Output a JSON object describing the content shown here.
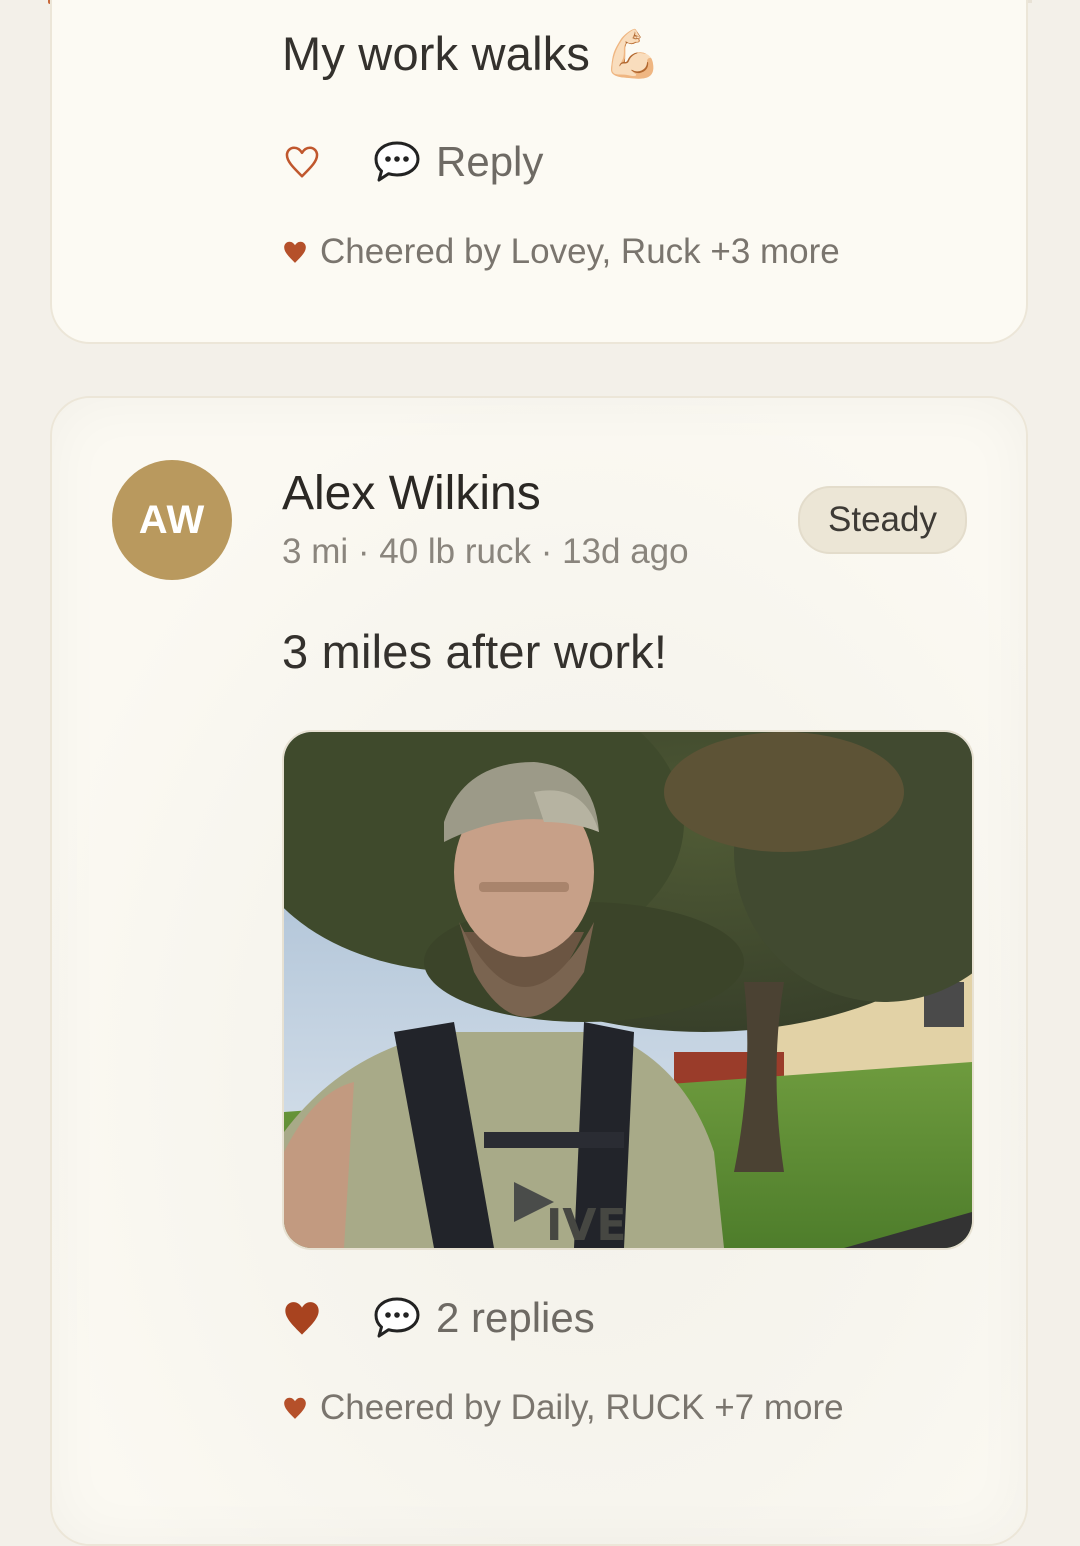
{
  "post1": {
    "text": "My work walks 💪🏻",
    "reply_label": "Reply",
    "cheers": "Cheered by Lovey, Ruck +3 more",
    "liked": false
  },
  "post2": {
    "avatar_initials": "AW",
    "author": "Alex Wilkins",
    "meta": "3 mi · 40 lb ruck · 13d ago",
    "badge": "Steady",
    "text": "3 miles after work!",
    "photo_print": "IVE",
    "replies_label": "2 replies",
    "cheers": "Cheered by Daily, RUCK +7 more",
    "liked": true
  },
  "colors": {
    "accent": "#c8693a",
    "heart_filled": "#a8431f",
    "avatar_bg": "#b9995e",
    "card_bg": "#fcfaf3"
  }
}
